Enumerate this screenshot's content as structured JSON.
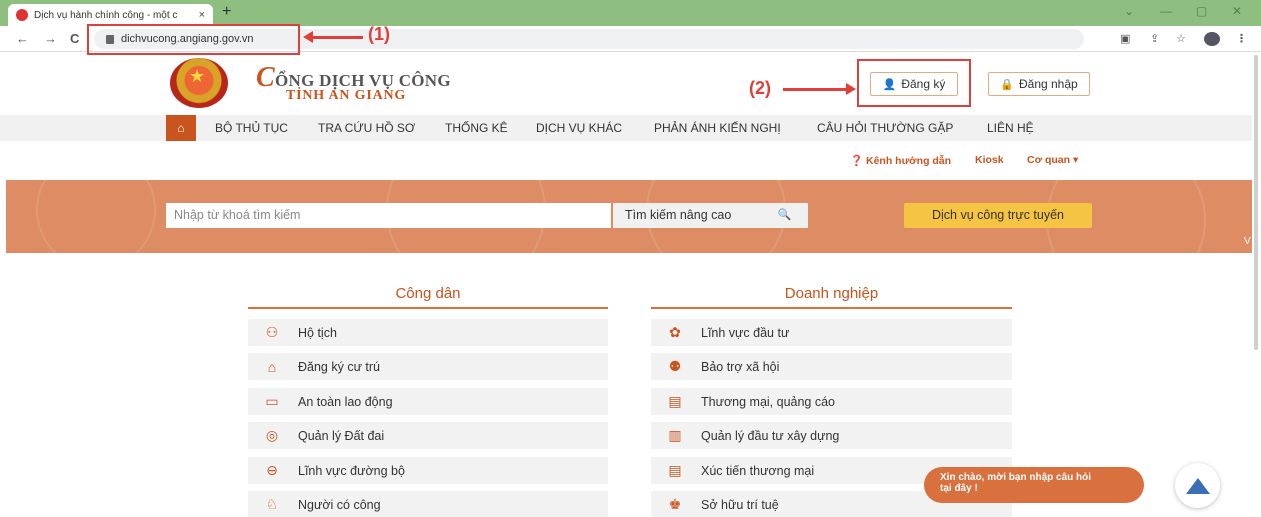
{
  "browser": {
    "tab_title": "Dịch vụ hành chính công - một c",
    "tab_close": "×",
    "new_tab": "+",
    "url": "dichvucong.angiang.gov.vn",
    "back": "←",
    "forward": "→",
    "reload": "C",
    "win_min": "—",
    "win_max": "▢",
    "win_close": "✕",
    "win_chevron": "⌄",
    "star": "☆",
    "menu_dots": "⋮"
  },
  "annotations": {
    "label_1": "(1)",
    "label_2": "(2)"
  },
  "site": {
    "name_initial": "C",
    "name_rest": "ỔNG DỊCH VỤ CÔNG",
    "subtitle": "TỈNH AN GIANG",
    "register_label": "Đăng ký",
    "login_label": "Đăng nhập"
  },
  "menu": {
    "items": [
      "BỘ THỦ TỤC",
      "TRA CỨU HỒ SƠ",
      "THỐNG KÊ",
      "DỊCH VỤ KHÁC",
      "PHẢN ÁNH KIẾN NGHỊ",
      "CÂU HỎI THƯỜNG GẶP",
      "LIÊN HỆ"
    ]
  },
  "util": {
    "guide": "Kênh hướng dẫn",
    "kiosk": "Kiosk",
    "agency": "Cơ quan"
  },
  "search": {
    "placeholder": "Nhập từ khoá tìm kiếm",
    "advanced": "Tìm kiếm nâng cao",
    "online_service": "Dịch vụ công trực tuyến",
    "more": "V"
  },
  "citizen": {
    "title": "Công dân",
    "items": [
      "Hộ tịch",
      "Đăng ký cư trú",
      "An toàn lao động",
      "Quản lý Đất đai",
      "Lĩnh vực đường bộ",
      "Người có công"
    ]
  },
  "business": {
    "title": "Doanh nghiệp",
    "items": [
      "Lĩnh vực đầu tư",
      "Bảo trợ xã hội",
      "Thương mại, quảng cáo",
      "Quản lý đầu tư xây dựng",
      "Xúc tiến thương mại",
      "Sở hữu trí tuệ"
    ]
  },
  "chat": {
    "line1": "Xin chào, mời bạn nhập câu hỏi",
    "line2": "tại đây !"
  }
}
